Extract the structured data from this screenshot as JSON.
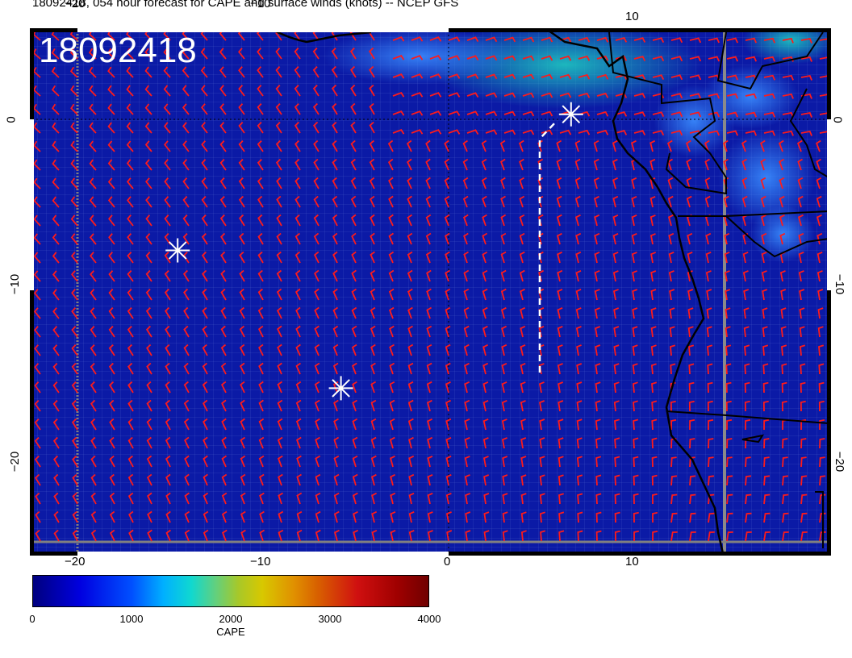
{
  "title": "18092418, 054 hour forecast for CAPE and surface winds (knots) -- NCEP GFS",
  "stamp": "18092418",
  "axes": {
    "top_ticks": [
      "−20",
      "−10",
      "10"
    ],
    "bottom_ticks": [
      "−20",
      "−10",
      "0",
      "10"
    ],
    "left_ticks": [
      "0",
      "−10",
      "−20"
    ],
    "right_ticks": [
      "0",
      "−10",
      "−20"
    ]
  },
  "colorbar": {
    "ticks": [
      "0",
      "1000",
      "2000",
      "3000",
      "4000"
    ],
    "label": "CAPE"
  },
  "colors": {
    "ocean": "#0a1aa8",
    "barb": "#ff1a1a",
    "coast": "#000000",
    "marker": "#ffffff"
  },
  "markers": [
    {
      "name": "marker-west",
      "lon": -14.6,
      "lat": -7.7
    },
    {
      "name": "marker-south",
      "lon": -5.8,
      "lat": -15.8
    },
    {
      "name": "marker-north",
      "lon": 6.6,
      "lat": 0.3
    }
  ]
}
